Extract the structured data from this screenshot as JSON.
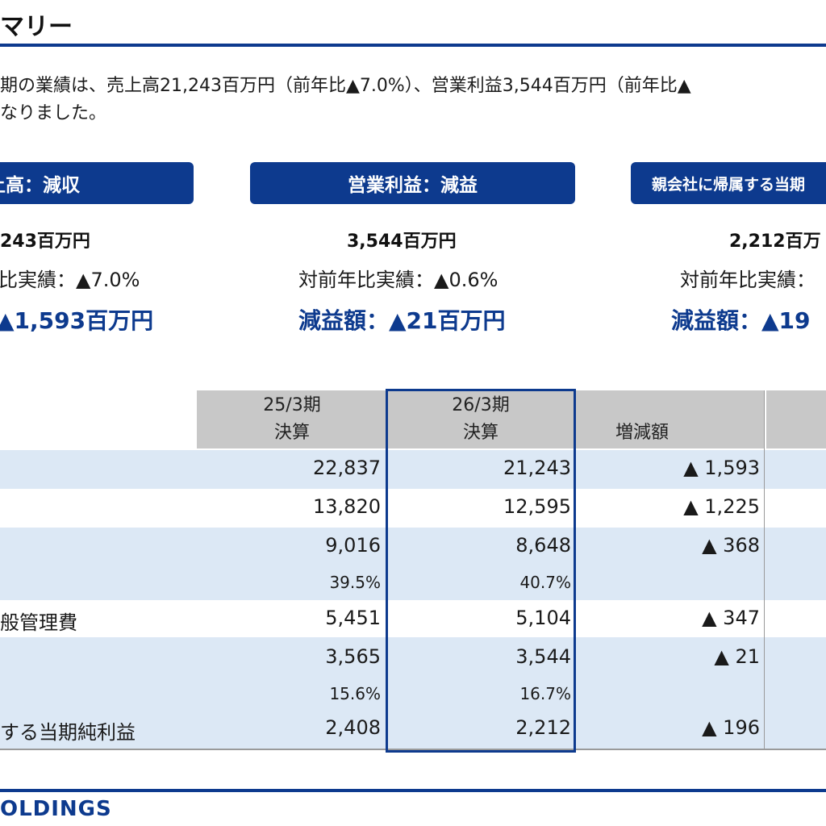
{
  "header": {
    "title": "マリー"
  },
  "summary": {
    "line1": "期の業績は、売上高21,243百万円（前年比▲7.0%）、営業利益3,544百万円（前年比▲",
    "line2": "なりました。"
  },
  "kpis": [
    {
      "label": "上高：減収",
      "amount": "243百万円",
      "yoy": "比実績：▲7.0%",
      "diff": "▲1,593百万円"
    },
    {
      "label": "営業利益：減益",
      "amount": "3,544百万円",
      "yoy": "対前年比実績：▲0.6%",
      "diff": "減益額：▲21百万円"
    },
    {
      "label": "親会社に帰属する当期",
      "amount": "2,212百万",
      "yoy": "対前年比実績：",
      "diff": "減益額：▲19"
    }
  ],
  "table": {
    "headers": {
      "prev": {
        "line1": "25/3期",
        "line2": "決算"
      },
      "curr": {
        "line1": "26/3期",
        "line2": "決算"
      },
      "diff": {
        "line1": "",
        "line2": "増減額"
      }
    },
    "rows": [
      {
        "label": "",
        "prev": "22,837",
        "curr": "21,243",
        "diff": "▲ 1,593",
        "kind": "num",
        "shaded": true
      },
      {
        "label": "",
        "prev": "13,820",
        "curr": "12,595",
        "diff": "▲ 1,225",
        "kind": "num",
        "shaded": false
      },
      {
        "label": "",
        "prev": "9,016",
        "curr": "8,648",
        "diff": "▲ 368",
        "kind": "num",
        "shaded": true
      },
      {
        "label": "",
        "prev": "39.5%",
        "curr": "40.7%",
        "diff": "",
        "kind": "pct",
        "shaded": true
      },
      {
        "label": "般管理費",
        "prev": "5,451",
        "curr": "5,104",
        "diff": "▲ 347",
        "kind": "num",
        "shaded": false
      },
      {
        "label": "",
        "prev": "3,565",
        "curr": "3,544",
        "diff": "▲ 21",
        "kind": "num",
        "shaded": true
      },
      {
        "label": "",
        "prev": "15.6%",
        "curr": "16.7%",
        "diff": "",
        "kind": "pct",
        "shaded": true
      },
      {
        "label": "する当期純利益",
        "prev": "2,408",
        "curr": "2,212",
        "diff": "▲ 196",
        "kind": "num",
        "shaded": true
      }
    ]
  },
  "footer": {
    "logo": "OLDINGS"
  },
  "colors": {
    "accent": "#0d3a8e",
    "row_shade": "#dce8f5",
    "header_gray": "#c8c8c8"
  }
}
